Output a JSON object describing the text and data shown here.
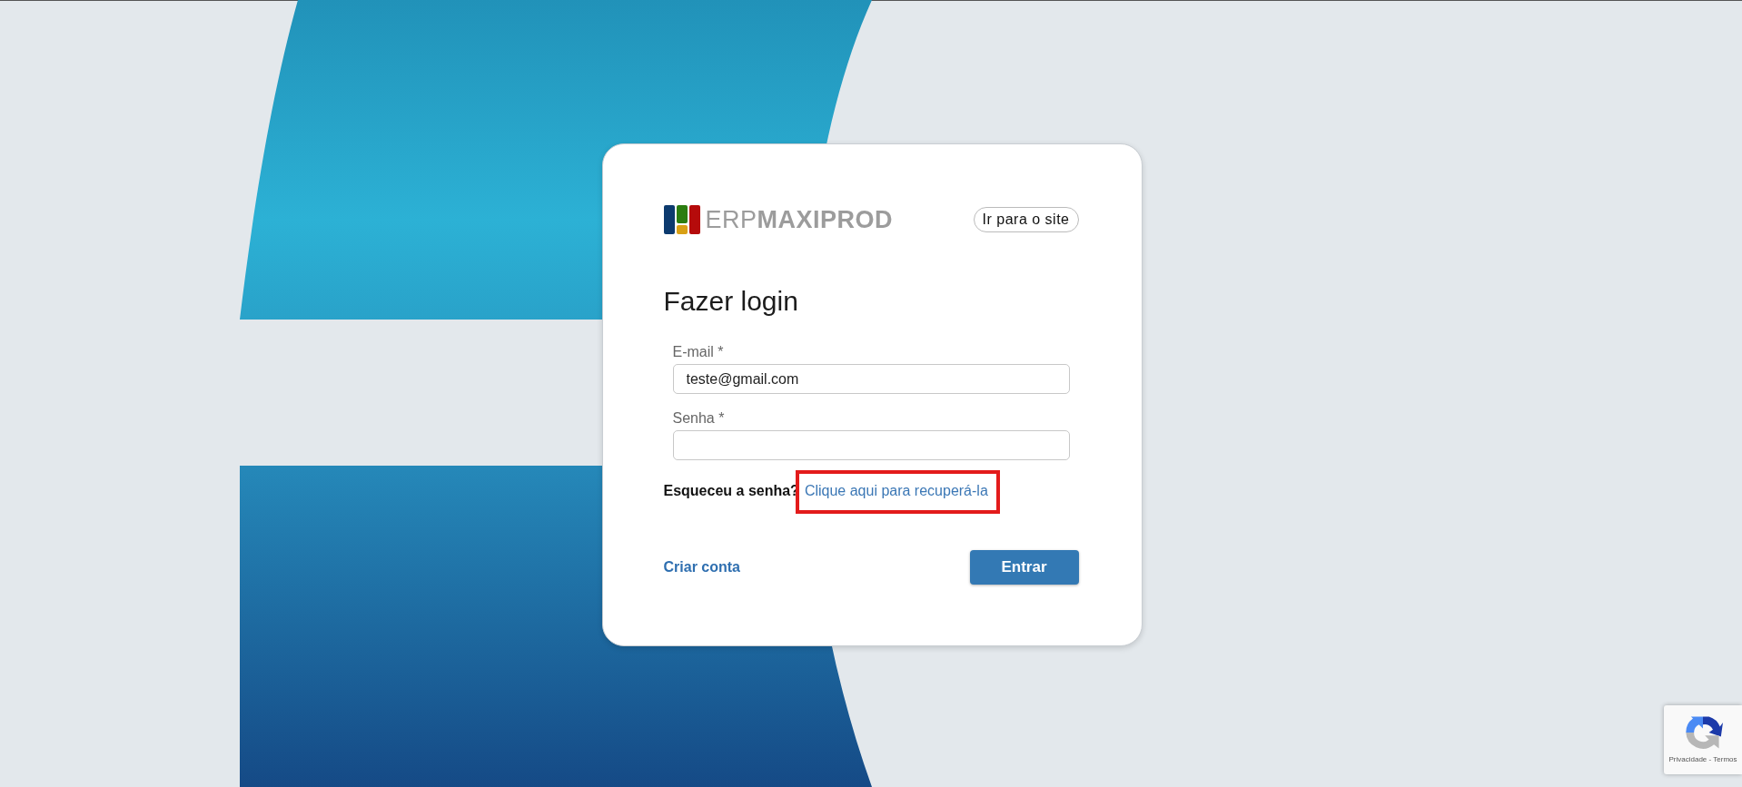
{
  "header": {
    "logo": "ERP**MAXIPROD**",
    "site_link": "Ir para o site"
  },
  "title": "Fazer login",
  "fields": [
    {
      "label": "E-mail *",
      "value": "teste@gmail.com",
      "kind": "text"
    },
    {
      "label": "Senha *",
      "kind": "password"
    }
  ],
  "forgot": {
    "question": "Esqueceu a senha?",
    "link": "Clique aqui para recuperá-la",
    "highlighted": true
  },
  "actions": {
    "create": "Criar conta",
    "submit": "Entrar"
  },
  "recaptcha": {
    "footer": "Privacidade - Termos"
  }
}
